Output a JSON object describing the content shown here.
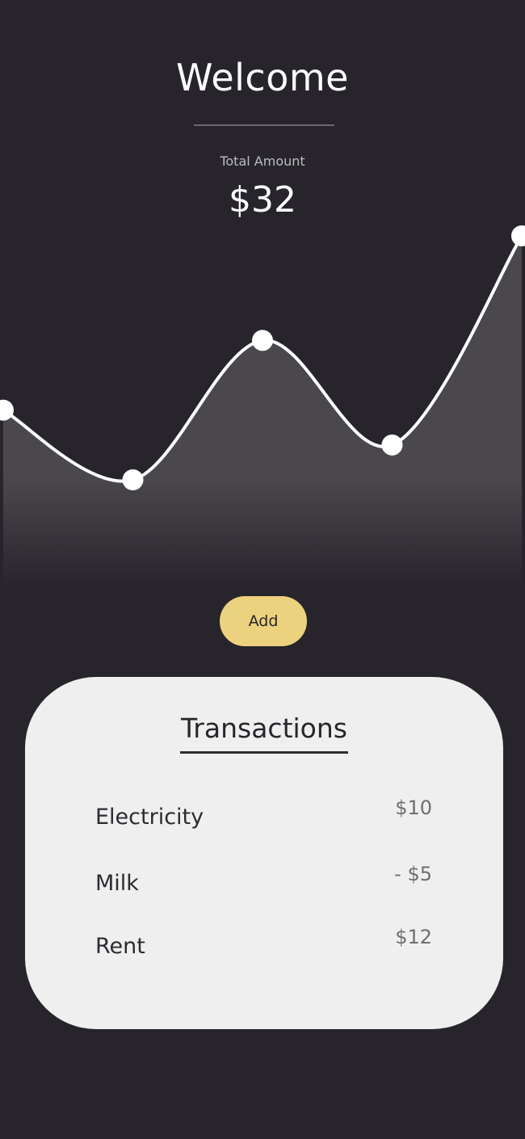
{
  "header": {
    "title": "Welcome",
    "total_label": "Total Amount",
    "total_value": "$32"
  },
  "chart_data": {
    "type": "area",
    "title": "",
    "xlabel": "",
    "ylabel": "",
    "x": [
      0,
      1,
      2,
      3,
      4
    ],
    "values": [
      4,
      0,
      8,
      2,
      14
    ],
    "point_count": 5,
    "grid": false,
    "legend": "none",
    "line_color": "#ffffff",
    "fill_color": "#4a484d"
  },
  "actions": {
    "add_label": "Add"
  },
  "transactions": {
    "title": "Transactions",
    "items": [
      {
        "name": "Electricity",
        "amount": "$10"
      },
      {
        "name": "Milk",
        "amount": "- $5"
      },
      {
        "name": "Rent",
        "amount": "$12"
      }
    ]
  },
  "colors": {
    "background": "#27252b",
    "accent": "#ecd27e",
    "card": "#efefef",
    "text_dark": "#27252b"
  }
}
